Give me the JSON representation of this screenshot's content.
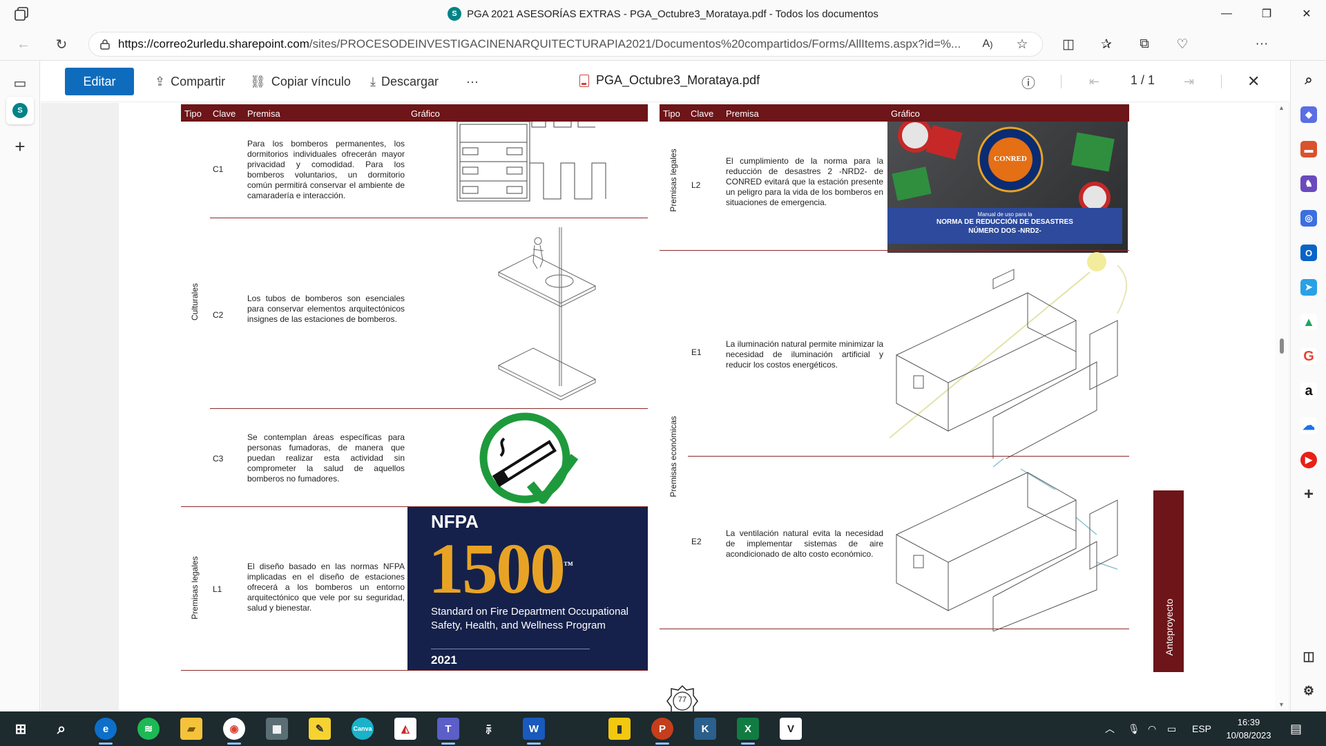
{
  "window": {
    "title": "PGA 2021 ASESORÍAS EXTRAS - PGA_Octubre3_Morataya.pdf - Todos los documentos",
    "minimize": "—",
    "maximize": "❐",
    "close": "✕"
  },
  "addressbar": {
    "url_host": "https://correo2urledu.sharepoint.com",
    "url_path": "/sites/PROCESODEINVESTIGACINENARQUITECTURAPIA2021/Documentos%20compartidos/Forms/AllItems.aspx?id=%..."
  },
  "viewer": {
    "edit_label": "Editar",
    "share_label": "Compartir",
    "copy_link_label": "Copiar vínculo",
    "download_label": "Descargar",
    "more_label": "···",
    "file_name": "PGA_Octubre3_Morataya.pdf",
    "page_indicator": "1 / 1"
  },
  "left_table": {
    "headers": {
      "tipo": "Tipo",
      "clave": "Clave",
      "premisa": "Premisa",
      "grafico": "Gráfico"
    },
    "group_culturales": "Culturales",
    "group_legales": "Premisas legales",
    "rows": [
      {
        "clave": "C1",
        "premisa": "Para los bomberos permanentes, los dormitorios individuales ofrecerán mayor privacidad y comodidad. Para los bomberos voluntarios, un dormitorio común permitirá conservar el ambiente de camaradería e interacción."
      },
      {
        "clave": "C2",
        "premisa": "Los tubos de bomberos son esenciales para conservar elementos arquitectónicos insignes de las estaciones de bomberos."
      },
      {
        "clave": "C3",
        "premisa": "Se contemplan áreas específicas para personas fumadoras, de manera que puedan realizar esta actividad sin comprometer la salud de aquellos bomberos no fumadores."
      },
      {
        "clave": "L1",
        "premisa": "El diseño basado en las normas NFPA implicadas en el diseño de estaciones ofrecerá a los bomberos un entorno arquitectónico que vele por su seguridad, salud y bienestar."
      }
    ],
    "nfpa": {
      "brand": "NFPA",
      "number": "1500",
      "tm": "™",
      "subtitle": "Standard on Fire Department Occupational Safety, Health, and Wellness Program",
      "year": "2021"
    }
  },
  "right_table": {
    "headers": {
      "tipo": "Tipo",
      "clave": "Clave",
      "premisa": "Premisa",
      "grafico": "Gráfico"
    },
    "group_legales": "Premisas legales",
    "group_economicas": "Premisas económicas",
    "rows": [
      {
        "clave": "L2",
        "premisa": "El cumplimiento de la norma para la reducción de desastres 2 -NRD2- de CONRED evitará que la estación presente un peligro para la vida de los bomberos en situaciones de emergencia."
      },
      {
        "clave": "E1",
        "premisa": "La iluminación natural permite minimizar la necesidad de iluminación artificial y reducir los costos energéticos."
      },
      {
        "clave": "E2",
        "premisa": "La ventilación natural evita la necesidad de implementar sistemas de aire acondicionado de alto costo económico."
      }
    ],
    "conred": {
      "logo_text": "CONRED",
      "manual_line": "Manual de uso para la",
      "title_line1": "NORMA DE REDUCCIÓN DE DESASTRES",
      "title_line2": "NÚMERO DOS -NRD2-"
    }
  },
  "side_tab": "Anteproyecto",
  "page_number": "77",
  "taskbar": {
    "language": "ESP",
    "time": "16:39",
    "date": "10/08/2023"
  }
}
